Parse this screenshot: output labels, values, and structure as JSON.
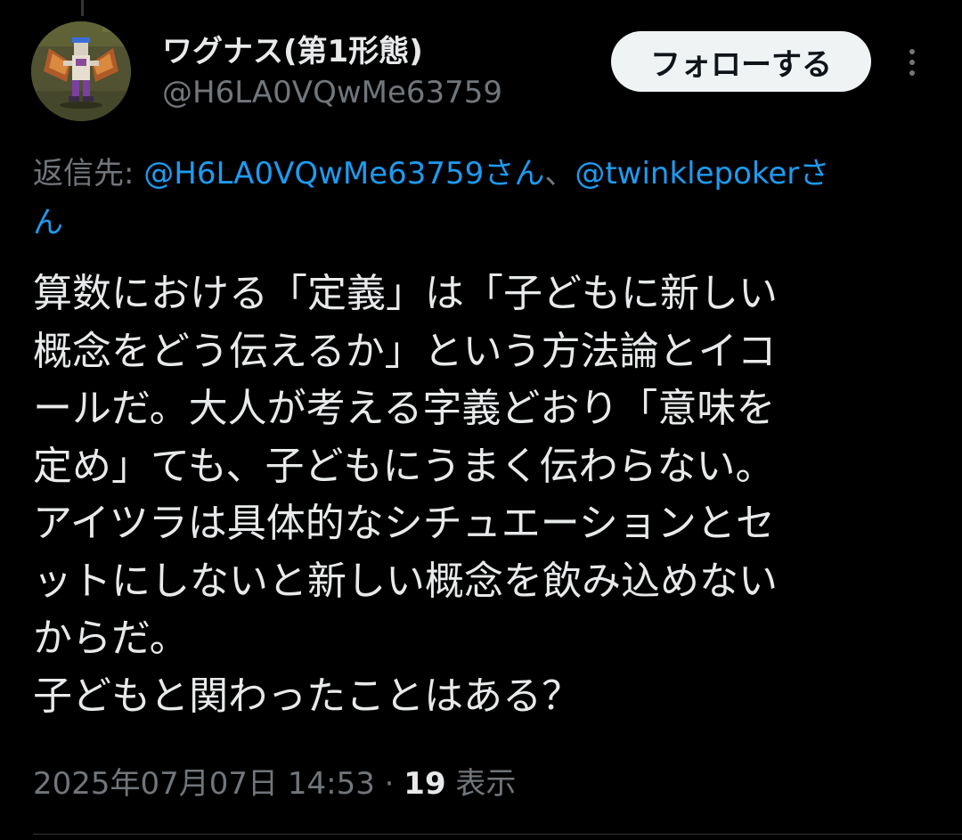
{
  "tweet": {
    "author": {
      "display_name": "ワグナス(第1形態)",
      "handle": "@H6LA0VQwMe63759",
      "avatar_icon": "pixel-art-winged-creature-avatar"
    },
    "follow_label": "フォローする",
    "more_icon": "more-vertical-icon",
    "reply": {
      "prefix": "返信先: ",
      "mention_1": "@H6LA0VQwMe63759さん",
      "separator": "、",
      "mention_2": "@twinklepokerさ",
      "mention_2_cont": "ん"
    },
    "body_lines": [
      "算数における「定義」は「子どもに新しい",
      "概念をどう伝えるか」という方法論とイコ",
      "ールだ。大人が考える字義どおり「意味を",
      "定め」ても、子どもにうまく伝わらない。",
      "アイツラは具体的なシチュエーションとセ",
      "ットにしないと新しい概念を飲み込めない",
      "からだ。",
      "子どもと関わったことはある？"
    ],
    "timestamp": "2025年07月07日 14:53",
    "dot_separator": " · ",
    "views_count": "19",
    "views_label": " 表示"
  },
  "colors": {
    "background": "#000000",
    "text_primary": "#e7e9ea",
    "text_secondary": "#71767b",
    "link": "#1d9bf0",
    "follow_button_bg": "#eff3f4",
    "follow_button_text": "#0f1419"
  }
}
